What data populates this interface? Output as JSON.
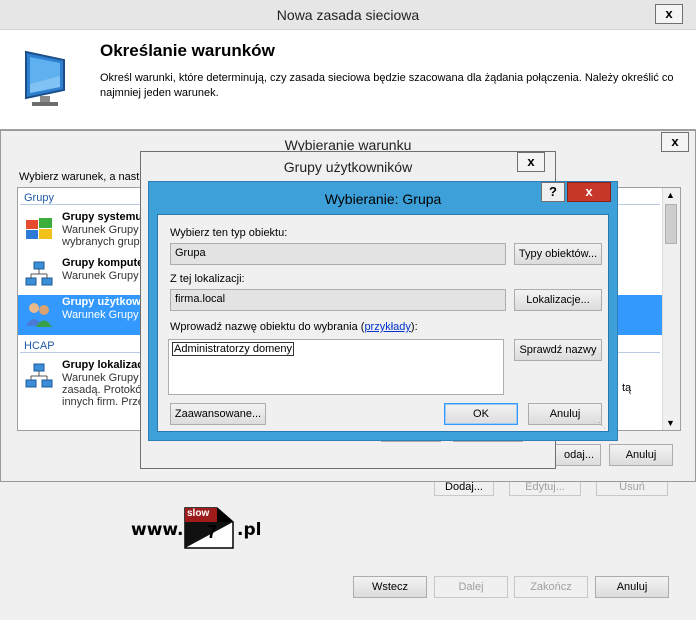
{
  "main_window": {
    "title": "Nowa zasada sieciowa",
    "close_label": "x",
    "header_title": "Określanie warunków",
    "header_desc": "Określ warunki, które determinują, czy zasada sieciowa będzie szacowana dla żądania połączenia. Należy określić co najmniej jeden warunek.",
    "buttons": {
      "add": "Dodaj...",
      "edit": "Edytuj...",
      "remove": "Usuń"
    },
    "footer": {
      "back": "Wstecz",
      "next": "Dalej",
      "finish": "Zakończ",
      "cancel": "Anuluj"
    }
  },
  "condition_window": {
    "title": "Wybieranie warunku",
    "close_label": "x",
    "instruction": "Wybierz warunek, a nast",
    "category_groups": "Grupy",
    "category_hcap": "HCAP",
    "items": [
      {
        "title": "Grupy systemu",
        "desc": "Warunek Grupy\nwybranych grup"
      },
      {
        "title": "Grupy kompute",
        "desc": "Warunek Grupy"
      },
      {
        "title": "Grupy użytkow",
        "desc": "Warunek Grupy"
      },
      {
        "title": "Grupy lokalizac",
        "desc": "Warunek Grupy\nzasadą. Protokó\ninnych firm. Prze"
      }
    ],
    "desc_tail": "tą",
    "add_button": "odaj...",
    "cancel_button": "Anuluj"
  },
  "groups_window": {
    "title": "Grupy użytkowników",
    "close_label": "x"
  },
  "select_group_window": {
    "title": "Wybieranie: Grupa",
    "help_label": "?",
    "close_label": "x",
    "object_type_label": "Wybierz ten typ obiektu:",
    "object_type_value": "Grupa",
    "object_types_button": "Typy obiektów...",
    "location_label": "Z tej lokalizacji:",
    "location_value": "firma.local",
    "locations_button": "Lokalizacje...",
    "names_label": "Wprowadź nazwę obiektu do wybrania (",
    "names_link": "przykłady",
    "names_label_end": "):",
    "names_value": "Administratorzy domeny",
    "check_names_button": "Sprawdź nazwy",
    "advanced_button": "Zaawansowane...",
    "ok_button": "OK",
    "cancel_button": "Anuluj"
  },
  "watermark": {
    "prefix": "www.",
    "top": "slow",
    "digit": "7",
    "suffix": ".pl"
  },
  "colors": {
    "accent": "#3399ff",
    "dialog_frame": "#3ea0d8",
    "category": "#1e5aa8"
  }
}
